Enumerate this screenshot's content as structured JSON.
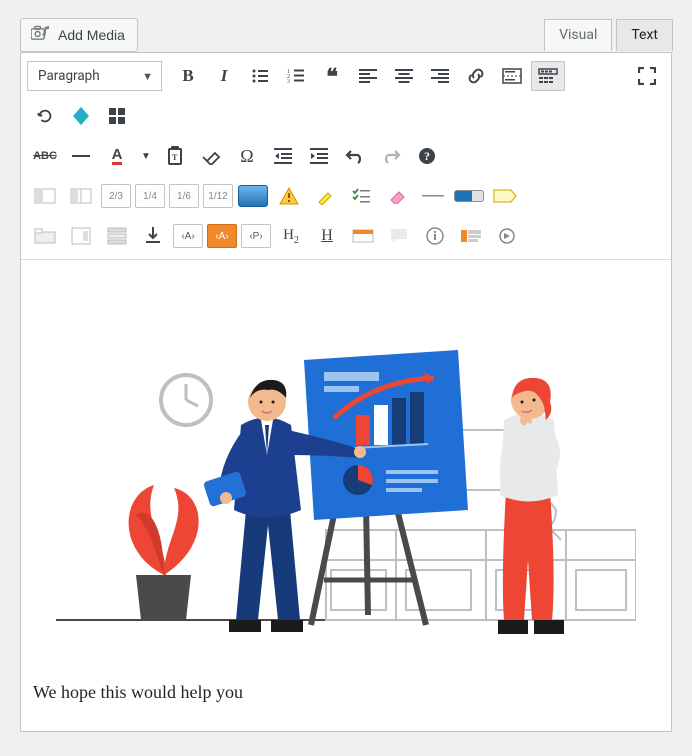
{
  "top": {
    "add_media_label": "Add Media",
    "tabs": [
      {
        "label": "Visual",
        "active": false
      },
      {
        "label": "Text",
        "active": true
      }
    ]
  },
  "format_select": {
    "current": "Paragraph"
  },
  "toolbar_row1": [
    {
      "name": "bold-button",
      "icon": "B",
      "title": "Bold"
    },
    {
      "name": "italic-button",
      "icon": "I",
      "title": "Italic"
    },
    {
      "name": "bulleted-list-button",
      "icon": "ul",
      "title": "Bulleted list"
    },
    {
      "name": "numbered-list-button",
      "icon": "ol",
      "title": "Numbered list"
    },
    {
      "name": "blockquote-button",
      "icon": "quote",
      "title": "Blockquote"
    },
    {
      "name": "align-left-button",
      "icon": "al",
      "title": "Align left"
    },
    {
      "name": "align-center-button",
      "icon": "ac",
      "title": "Align center"
    },
    {
      "name": "align-right-button",
      "icon": "ar",
      "title": "Align right"
    },
    {
      "name": "insert-link-button",
      "icon": "link",
      "title": "Insert/edit link"
    },
    {
      "name": "insert-more-button",
      "icon": "more",
      "title": "Insert Read More tag"
    },
    {
      "name": "toolbar-toggle-button",
      "icon": "kitchen",
      "title": "Toolbar Toggle",
      "active": true
    },
    {
      "name": "fullscreen-button",
      "icon": "expand",
      "title": "Fullscreen",
      "push": true
    }
  ],
  "toolbar_row1b": [
    {
      "name": "refresh-button",
      "icon": "refresh",
      "title": "Refresh"
    },
    {
      "name": "builder-button",
      "icon": "builder",
      "title": "Page Builder"
    },
    {
      "name": "grid-button",
      "icon": "grid",
      "title": "Grid"
    }
  ],
  "toolbar_row2": [
    {
      "name": "strikethrough-button",
      "icon": "strike",
      "title": "Strikethrough"
    },
    {
      "name": "horizontal-line-button",
      "icon": "hr",
      "title": "Horizontal line"
    },
    {
      "name": "text-color-button",
      "icon": "A_color",
      "title": "Text color"
    },
    {
      "name": "text-color-chevron",
      "icon": "chev",
      "title": "More colors"
    },
    {
      "name": "paste-button",
      "icon": "paste",
      "title": "Paste as text"
    },
    {
      "name": "clear-format-button",
      "icon": "eraser",
      "title": "Clear formatting"
    },
    {
      "name": "special-char-button",
      "icon": "omega",
      "title": "Special character"
    },
    {
      "name": "outdent-button",
      "icon": "outdent",
      "title": "Decrease indent"
    },
    {
      "name": "indent-button",
      "icon": "indent",
      "title": "Increase indent"
    },
    {
      "name": "undo-button",
      "icon": "undo",
      "title": "Undo"
    },
    {
      "name": "redo-button",
      "icon": "redo",
      "title": "Redo"
    },
    {
      "name": "help-button",
      "icon": "help",
      "title": "Help"
    }
  ],
  "toolbar_row3": [
    {
      "name": "col-1-1",
      "icon": "c11",
      "title": "Full width"
    },
    {
      "name": "col-1-2",
      "icon": "c12",
      "title": "Half"
    },
    {
      "name": "col-2-3",
      "label": "2/3"
    },
    {
      "name": "col-1-4",
      "label": "1/4"
    },
    {
      "name": "col-1-6",
      "label": "1/6"
    },
    {
      "name": "col-1-12",
      "label": "1/12"
    },
    {
      "name": "button-shortcode",
      "icon": "btn",
      "title": "Button"
    },
    {
      "name": "alert-shortcode",
      "icon": "warn",
      "title": "Alert"
    },
    {
      "name": "highlight-shortcode",
      "icon": "hl",
      "title": "Highlight"
    },
    {
      "name": "checklist-shortcode",
      "icon": "chk",
      "title": "Checklist"
    },
    {
      "name": "clear-shortcode",
      "icon": "erase2",
      "title": "Clear"
    },
    {
      "name": "divider-shortcode",
      "icon": "hr2",
      "title": "Divider"
    },
    {
      "name": "progress-shortcode",
      "icon": "prog",
      "title": "Progress"
    },
    {
      "name": "label-shortcode",
      "icon": "lbl",
      "title": "Label"
    }
  ],
  "toolbar_row4": [
    {
      "name": "tabs-shortcode",
      "icon": "tabs",
      "title": "Tabs"
    },
    {
      "name": "toggle-shortcode",
      "icon": "toggle",
      "title": "Toggle"
    },
    {
      "name": "accordion-shortcode",
      "icon": "accord",
      "title": "Accordion"
    },
    {
      "name": "download-shortcode",
      "icon": "dl",
      "title": "Download"
    },
    {
      "name": "code-a",
      "label": "‹A›"
    },
    {
      "name": "code-a-orange",
      "label": "‹A›",
      "orange": true
    },
    {
      "name": "code-p",
      "label": "‹P›"
    },
    {
      "name": "heading2",
      "icon": "h2",
      "title": "Heading 2"
    },
    {
      "name": "underline2",
      "icon": "H_u",
      "title": "Underline"
    },
    {
      "name": "note-shortcode",
      "icon": "note",
      "title": "Note"
    },
    {
      "name": "chat-shortcode",
      "icon": "chat",
      "title": "Chat"
    },
    {
      "name": "info-shortcode",
      "icon": "info",
      "title": "Info"
    },
    {
      "name": "columns-shortcode",
      "icon": "cols",
      "title": "Columns"
    },
    {
      "name": "embed-shortcode",
      "icon": "embed",
      "title": "Embed"
    }
  ],
  "icons": {
    "add_media": "camera-music"
  },
  "content": {
    "image_alt": "Illustration of two people presenting a chart on an easel",
    "paragraph": "We hope this would help you"
  }
}
